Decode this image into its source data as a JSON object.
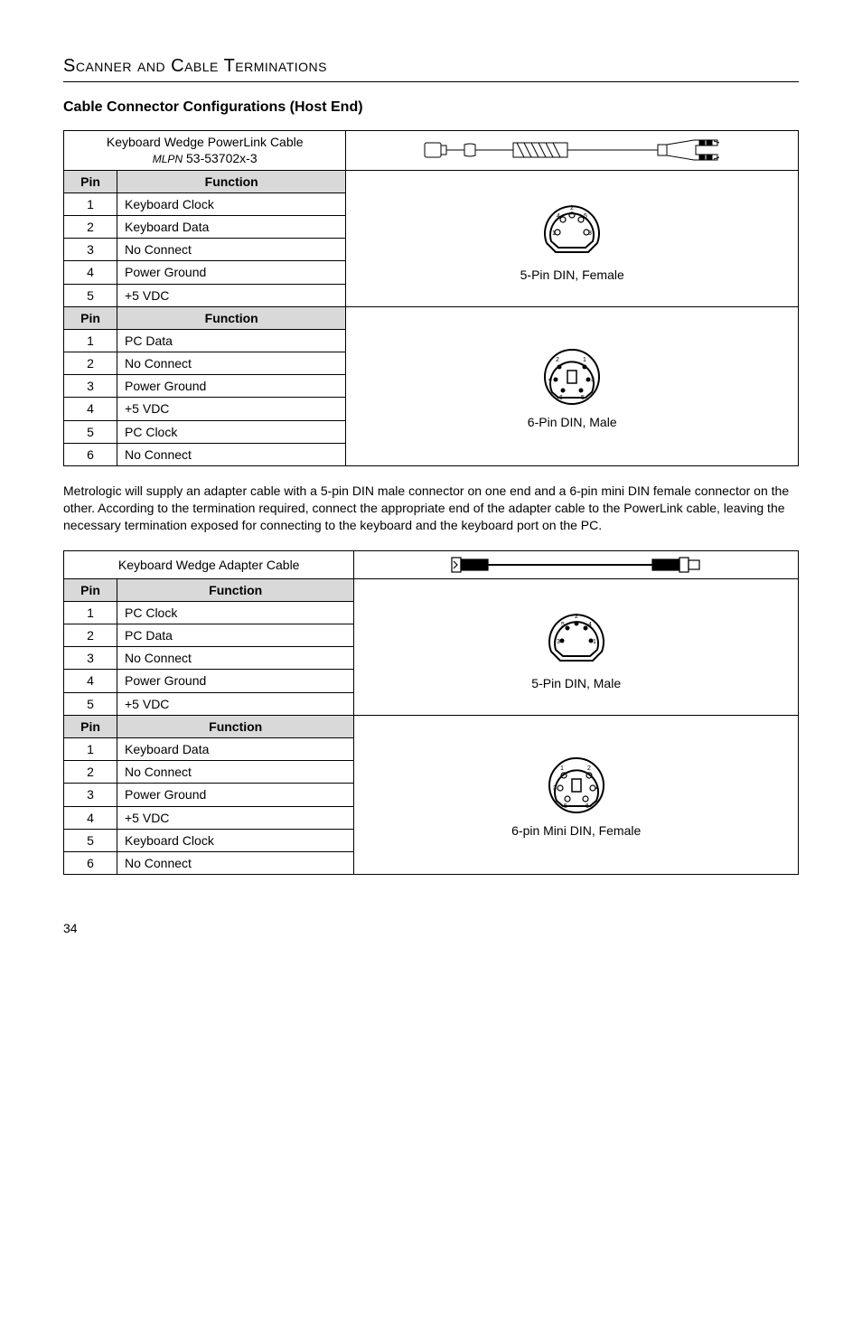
{
  "section_title": "Scanner and Cable Terminations",
  "subheading": "Cable Connector Configurations (Host End)",
  "table1": {
    "title_line1": "Keyboard Wedge PowerLink Cable",
    "title_line2_prefix": "MLPN",
    "title_line2_value": " 53-53702x-3",
    "col_pin": "Pin",
    "col_func": "Function",
    "group1_rows": [
      {
        "pin": "1",
        "func": "Keyboard Clock"
      },
      {
        "pin": "2",
        "func": "Keyboard Data"
      },
      {
        "pin": "3",
        "func": "No Connect"
      },
      {
        "pin": "4",
        "func": "Power Ground"
      },
      {
        "pin": "5",
        "func": "+5 VDC"
      }
    ],
    "group1_caption": "5-Pin DIN, Female",
    "group2_rows": [
      {
        "pin": "1",
        "func": "PC Data"
      },
      {
        "pin": "2",
        "func": "No Connect"
      },
      {
        "pin": "3",
        "func": "Power Ground"
      },
      {
        "pin": "4",
        "func": "+5 VDC"
      },
      {
        "pin": "5",
        "func": "PC Clock"
      },
      {
        "pin": "6",
        "func": "No Connect"
      }
    ],
    "group2_caption": "6-Pin DIN, Male"
  },
  "paragraph": "Metrologic will supply an adapter cable with a 5-pin DIN male connector on one end and a 6-pin mini DIN female connector on the other.  According to the termination required, connect the appropriate end of the adapter cable to the PowerLink cable, leaving the necessary termination exposed for connecting to the keyboard and the keyboard port on the PC.",
  "table2": {
    "title": "Keyboard Wedge Adapter Cable",
    "col_pin": "Pin",
    "col_func": "Function",
    "group1_rows": [
      {
        "pin": "1",
        "func": "PC Clock"
      },
      {
        "pin": "2",
        "func": "PC Data"
      },
      {
        "pin": "3",
        "func": "No Connect"
      },
      {
        "pin": "4",
        "func": "Power Ground"
      },
      {
        "pin": "5",
        "func": "+5 VDC"
      }
    ],
    "group1_caption": "5-Pin DIN, Male",
    "group2_rows": [
      {
        "pin": "1",
        "func": "Keyboard Data"
      },
      {
        "pin": "2",
        "func": "No Connect"
      },
      {
        "pin": "3",
        "func": "Power Ground"
      },
      {
        "pin": "4",
        "func": "+5 VDC"
      },
      {
        "pin": "5",
        "func": "Keyboard Clock"
      },
      {
        "pin": "6",
        "func": "No Connect"
      }
    ],
    "group2_caption": "6-pin Mini DIN, Female"
  },
  "page_number": "34"
}
